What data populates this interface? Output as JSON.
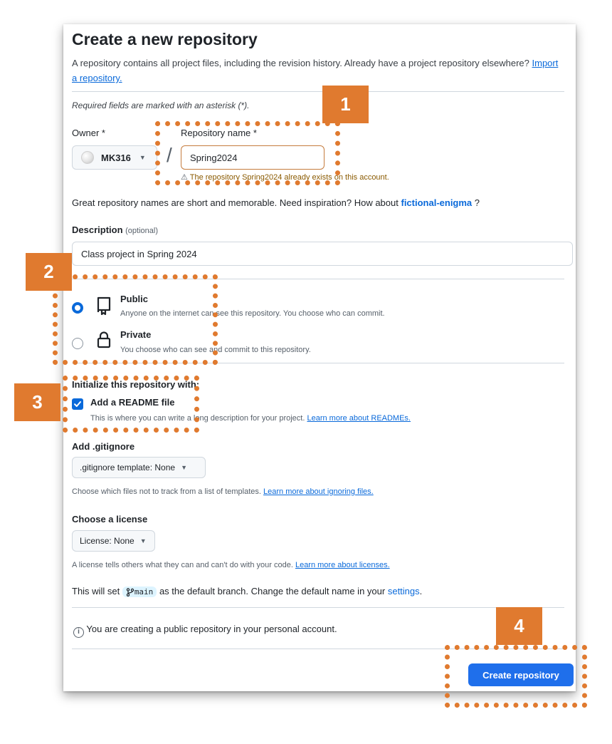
{
  "header": {
    "title": "Create a new repository",
    "intro": "A repository contains all project files, including the revision history. Already have a project repository elsewhere?",
    "import_link": "Import a repository."
  },
  "required_note": "Required fields are marked with an asterisk (*).",
  "owner": {
    "label": "Owner *",
    "value": "MK316"
  },
  "repo_name": {
    "label": "Repository name *",
    "value": "Spring2024",
    "warning": "The repository Spring2024 already exists on this account."
  },
  "suggestion": {
    "text": "Great repository names are short and memorable. Need inspiration? How about",
    "name": "fictional-enigma",
    "tail": "?"
  },
  "description": {
    "label": "Description",
    "optional": "(optional)",
    "value": "Class project in Spring 2024"
  },
  "visibility": {
    "public": {
      "title": "Public",
      "desc": "Anyone on the internet can see this repository. You choose who can commit.",
      "selected": true
    },
    "private": {
      "title": "Private",
      "desc": "You choose who can see and commit to this repository.",
      "selected": false
    }
  },
  "initialize": {
    "heading": "Initialize this repository with:",
    "readme_label": "Add a README file",
    "readme_checked": true,
    "readme_desc": "This is where you can write a long description for your project.",
    "readme_link": "Learn more about READMEs."
  },
  "gitignore": {
    "heading": "Add .gitignore",
    "select": ".gitignore template: None",
    "desc": "Choose which files not to track from a list of templates.",
    "link": "Learn more about ignoring files."
  },
  "license": {
    "heading": "Choose a license",
    "select": "License: None",
    "desc": "A license tells others what they can and can't do with your code.",
    "link": "Learn more about licenses."
  },
  "branch": {
    "prefix": "This will set",
    "name": "main",
    "middle": "as the default branch. Change the default name in your",
    "settings": "settings",
    "suffix": "."
  },
  "info_note": "You are creating a public repository in your personal account.",
  "create_button": "Create repository",
  "annotations": {
    "badge1": "1",
    "badge2": "2",
    "badge3": "3",
    "badge4": "4",
    "color": "#e07a2f"
  },
  "colors": {
    "primary": "#1f6feb",
    "link": "#0969da",
    "annotation": "#e07a2f"
  }
}
